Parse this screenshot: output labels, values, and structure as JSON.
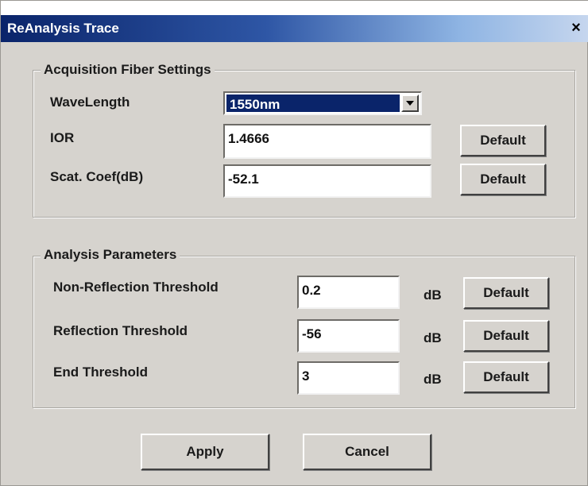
{
  "window": {
    "title": "ReAnalysis Trace",
    "close_glyph": "×"
  },
  "acquisition": {
    "legend": "Acquisition Fiber Settings",
    "wavelength_label": "WaveLength",
    "wavelength_value": "1550nm",
    "ior_label": "IOR",
    "ior_value": "1.4666",
    "scat_label": "Scat. Coef(dB)",
    "scat_value": "-52.1",
    "default_label": "Default"
  },
  "analysis": {
    "legend": "Analysis Parameters",
    "rows": [
      {
        "label": "Non-Reflection Threshold",
        "value": "0.2",
        "unit": "dB",
        "default_label": "Default"
      },
      {
        "label": "Reflection Threshold",
        "value": "-56",
        "unit": "dB",
        "default_label": "Default"
      },
      {
        "label": "End Threshold",
        "value": "3",
        "unit": "dB",
        "default_label": "Default"
      }
    ]
  },
  "actions": {
    "apply_label": "Apply",
    "cancel_label": "Cancel"
  },
  "icons": {
    "dropdown": "chevron-down-icon",
    "close": "close-icon"
  },
  "colors": {
    "titlebar_start": "#0a246a",
    "titlebar_end": "#c6d6ee",
    "selection": "#0a246a",
    "dialog_face": "#d6d3ce"
  }
}
